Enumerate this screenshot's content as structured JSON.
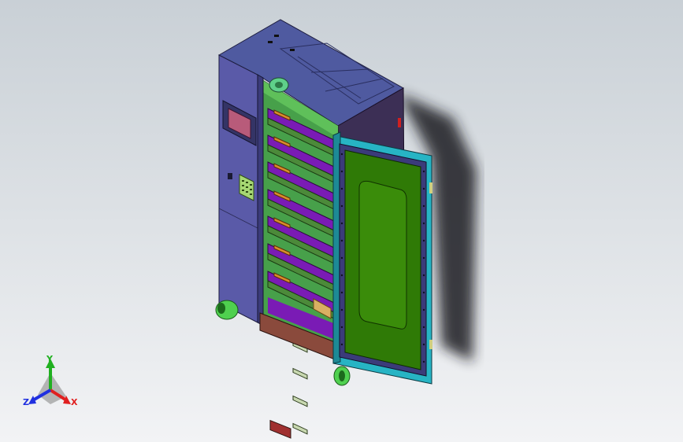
{
  "view": {
    "background_top": "#c9d0d6",
    "background_bottom": "#f2f3f5"
  },
  "model": {
    "colors": {
      "cabinet_front": "#5a5aa8",
      "cabinet_top": "#4f5aa0",
      "cabinet_side": "#3c2f55",
      "shelf_purple": "#7a1bb5",
      "shelf_green": "#4c8a3a",
      "door_panel": "#2f7a06",
      "door_frame": "#27b4c4",
      "brass": "#d98c2c",
      "base_rail": "#8a4a3c",
      "caster": "#4fd04f"
    }
  },
  "triad": {
    "x_label": "X",
    "y_label": "Y",
    "z_label": "Z",
    "x_color": "#e02020",
    "y_color": "#20b020",
    "z_color": "#2030e0"
  }
}
